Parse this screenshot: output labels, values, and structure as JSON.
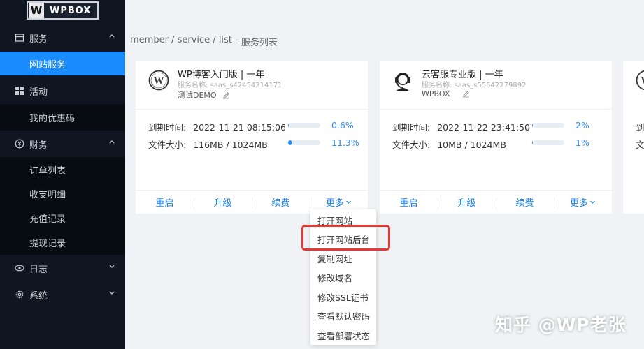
{
  "logo": {
    "mark": "W",
    "text": "WPBOX"
  },
  "sidebar": {
    "groups": [
      {
        "label": "服务",
        "icon": "store-icon",
        "items": [
          "网站服务"
        ]
      },
      {
        "label": "活动",
        "icon": "grid-icon",
        "items": [
          "我的优惠码"
        ]
      },
      {
        "label": "财务",
        "icon": "yen-icon",
        "items": [
          "订单列表",
          "收支明细",
          "充值记录",
          "提现记录"
        ]
      },
      {
        "label": "日志",
        "icon": "eye-icon",
        "items": []
      },
      {
        "label": "系统",
        "icon": "gear-icon",
        "items": []
      }
    ],
    "active_item": "网站服务"
  },
  "breadcrumb": [
    "member",
    " / ",
    "service",
    " / ",
    "list",
    " - ",
    "服务列表"
  ],
  "cards": [
    {
      "title": "WP博客入门版 | 一年",
      "service_name": "服务名称: saas_s42454214171",
      "owner": "测试DEMO",
      "expire_label": "到期时间:",
      "expire_value": "2022-11-21 08:15:06",
      "expire_pct": "0.6%",
      "expire_progress": 0.006,
      "size_label": "文件大小:",
      "size_value": "116MB / 1024MB",
      "size_pct": "11.3%",
      "size_progress": 0.113,
      "actions": [
        "重启",
        "升级",
        "续费",
        "更多"
      ]
    },
    {
      "title": "云客服专业版 | 一年",
      "service_name": "服务名称: saas_s55542279892",
      "owner": "WPBOX",
      "expire_label": "到期时间:",
      "expire_value": "2022-11-22 23:41:50",
      "expire_pct": "2%",
      "expire_progress": 0.02,
      "size_label": "文件大小:",
      "size_value": "10MB / 1024MB",
      "size_pct": "1%",
      "size_progress": 0.01,
      "actions": [
        "重启",
        "升级",
        "续费",
        "更多"
      ]
    }
  ],
  "partial_card": {
    "labels": [
      "到",
      "文"
    ]
  },
  "dropdown": [
    "打开网站",
    "打开网站后台",
    "复制网址",
    "修改域名",
    "修改SSL证书",
    "查看默认密码",
    "查看部署状态"
  ],
  "highlighted_item": "打开网站后台",
  "watermark": "知乎 @WP老张",
  "colors": {
    "accent": "#1a8cff",
    "sidebar_bg": "#0f1621",
    "highlight": "#e43935"
  }
}
